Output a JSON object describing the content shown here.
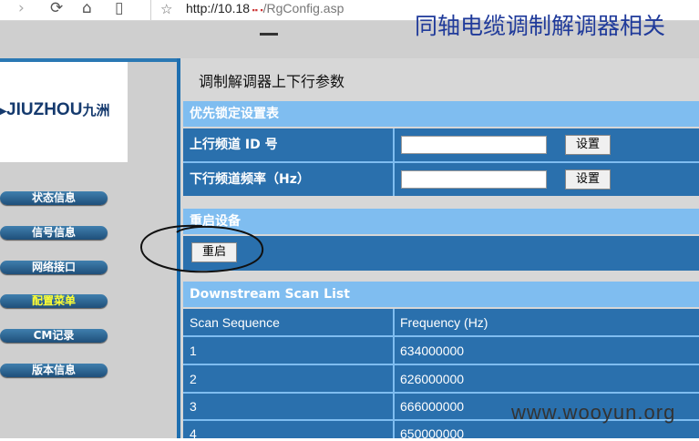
{
  "browser": {
    "url_host": "http://10.18",
    "url_path": "/RgConfig.asp"
  },
  "page": {
    "headline": "同轴电缆调制解调器相关",
    "title": "调制解调器上下行参数"
  },
  "sidebar": {
    "logo_latin": "JIUZHOU",
    "logo_cn": "九洲",
    "items": [
      {
        "label": "状态信息",
        "active": false
      },
      {
        "label": "信号信息",
        "active": false
      },
      {
        "label": "网络接口",
        "active": false
      },
      {
        "label": "配置菜单",
        "active": true
      },
      {
        "label": "CM记录",
        "active": false
      },
      {
        "label": "版本信息",
        "active": false
      }
    ]
  },
  "priority_lock": {
    "header": "优先锁定设置表",
    "upstream_label": "上行频道 ID 号",
    "upstream_value": "",
    "upstream_button": "设置",
    "downstream_label": "下行频道频率（Hz）",
    "downstream_value": "",
    "downstream_button": "设置"
  },
  "restart": {
    "header": "重启设备",
    "button": "重启"
  },
  "scan_list": {
    "header": "Downstream Scan List",
    "columns": [
      "Scan Sequence",
      "Frequency (Hz)"
    ],
    "rows": [
      [
        "1",
        "634000000"
      ],
      [
        "2",
        "626000000"
      ],
      [
        "3",
        "666000000"
      ],
      [
        "4",
        "650000000"
      ]
    ]
  },
  "watermark": "www.wooyun.org",
  "colors": {
    "header_blue": "#7fbdf0",
    "row_blue": "#2a70ad",
    "active_menu": "#ffff33"
  }
}
